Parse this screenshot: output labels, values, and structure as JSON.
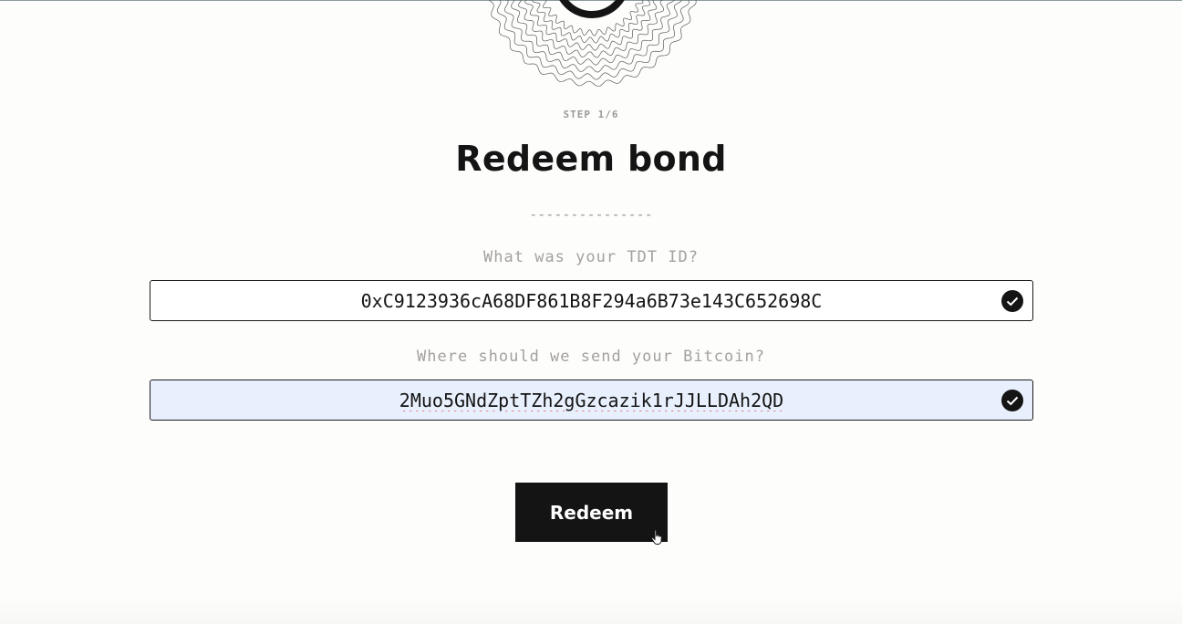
{
  "step": {
    "label": "STEP 1/6"
  },
  "page": {
    "title": "Redeem bond",
    "divider": "---------------"
  },
  "form": {
    "tdt_id": {
      "label": "What was your TDT ID?",
      "value": "0xC9123936cA68DF861B8F294a6B73e143C652698C",
      "valid": true
    },
    "bitcoin_address": {
      "label": "Where should we send your Bitcoin?",
      "value": "2Muo5GNdZptTZh2gGzcazik1rJJLLDAh2QD",
      "valid": true
    },
    "submit_label": "Redeem"
  },
  "icons": {
    "emblem": "guilloche-emblem-icon",
    "valid": "check-circle-icon",
    "cursor": "hand-pointer-icon"
  },
  "colors": {
    "button_background": "#141414",
    "autofill_background": "#e9f0fd",
    "label_text": "#a4a0a0"
  }
}
